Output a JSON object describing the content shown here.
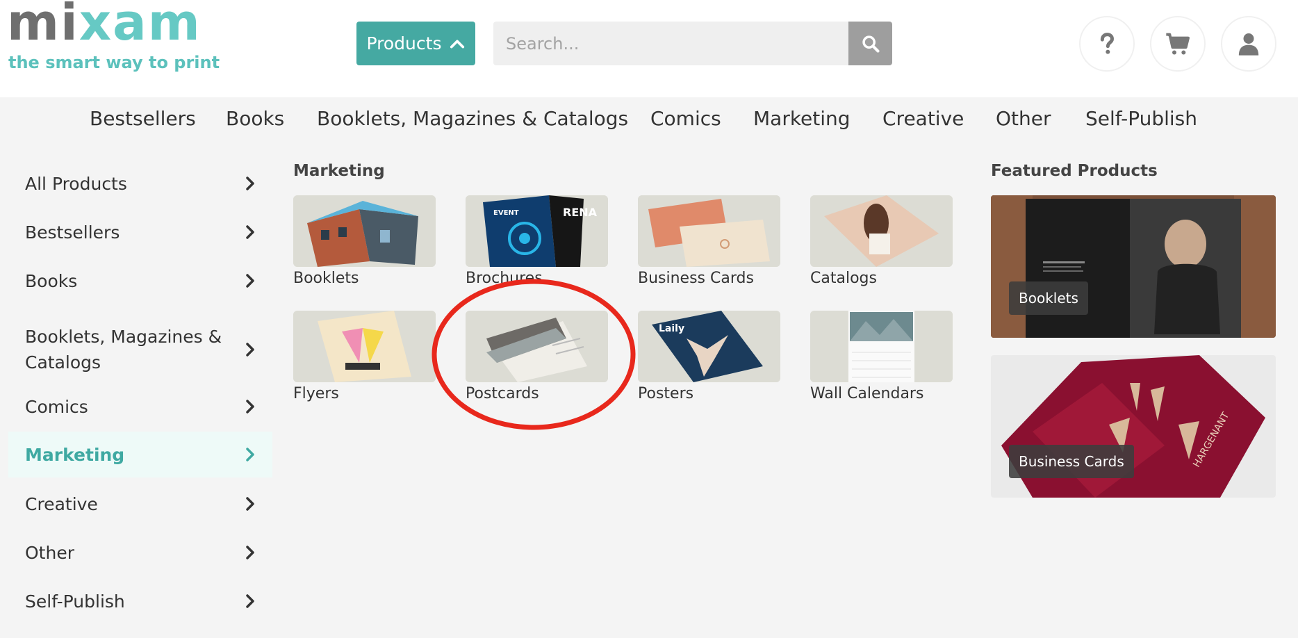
{
  "logo": {
    "word_a": "mi",
    "word_b": "xam",
    "tagline": "the smart way to print"
  },
  "header": {
    "products_label": "Products",
    "search_placeholder": "Search..."
  },
  "topnav": [
    "Bestsellers",
    "Books",
    "Booklets, Magazines & Catalogs",
    "Comics",
    "Marketing",
    "Creative",
    "Other",
    "Self-Publish"
  ],
  "sidebar": [
    {
      "label": "All Products"
    },
    {
      "label": "Bestsellers"
    },
    {
      "label": "Books"
    },
    {
      "label": "Booklets, Magazines & Catalogs"
    },
    {
      "label": "Comics"
    },
    {
      "label": "Marketing",
      "active": true
    },
    {
      "label": "Creative"
    },
    {
      "label": "Other"
    },
    {
      "label": "Self-Publish"
    }
  ],
  "main": {
    "title": "Marketing",
    "products": [
      {
        "label": "Booklets"
      },
      {
        "label": "Brochures"
      },
      {
        "label": "Business Cards"
      },
      {
        "label": "Catalogs"
      },
      {
        "label": "Flyers"
      },
      {
        "label": "Postcards"
      },
      {
        "label": "Posters"
      },
      {
        "label": "Wall Calendars"
      }
    ]
  },
  "featured": {
    "title": "Featured Products",
    "items": [
      {
        "label": "Booklets"
      },
      {
        "label": "Business Cards"
      }
    ]
  },
  "colors": {
    "accent": "#45a9a2",
    "active_text": "#3fa9a2",
    "annotation": "#e8281c"
  }
}
